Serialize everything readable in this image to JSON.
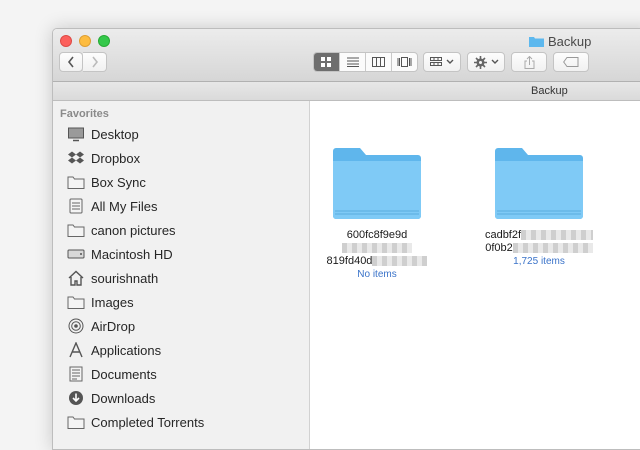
{
  "window": {
    "title": "Backup",
    "path_title": "Backup"
  },
  "toolbar": {
    "back_icon": "chevron-left-icon",
    "forward_icon": "chevron-right-icon",
    "view_modes": [
      "icon-view",
      "list-view",
      "column-view",
      "cover-flow-view"
    ],
    "active_view": "icon-view"
  },
  "sidebar": {
    "heading": "Favorites",
    "items": [
      {
        "label": "Desktop",
        "icon": "desktop-icon"
      },
      {
        "label": "Dropbox",
        "icon": "dropbox-icon"
      },
      {
        "label": "Box Sync",
        "icon": "folder-icon"
      },
      {
        "label": "All My Files",
        "icon": "all-files-icon"
      },
      {
        "label": "canon pictures",
        "icon": "folder-icon"
      },
      {
        "label": "Macintosh HD",
        "icon": "hard-drive-icon"
      },
      {
        "label": "sourishnath",
        "icon": "home-icon"
      },
      {
        "label": "Images",
        "icon": "folder-icon"
      },
      {
        "label": "AirDrop",
        "icon": "airdrop-icon"
      },
      {
        "label": "Applications",
        "icon": "applications-icon"
      },
      {
        "label": "Documents",
        "icon": "documents-icon"
      },
      {
        "label": "Downloads",
        "icon": "downloads-icon"
      },
      {
        "label": "Completed Torrents",
        "icon": "folder-icon"
      }
    ]
  },
  "content": {
    "folders": [
      {
        "name_line1": "600fc8f9e9d",
        "name_line2": "819fd40d",
        "subtitle": "No items"
      },
      {
        "name_line1": "cadbf2f",
        "name_line2": "0f0b2",
        "subtitle": "1,725 items"
      }
    ]
  },
  "colors": {
    "folder": "#5db8ee",
    "accent_link": "#3a73c9"
  }
}
